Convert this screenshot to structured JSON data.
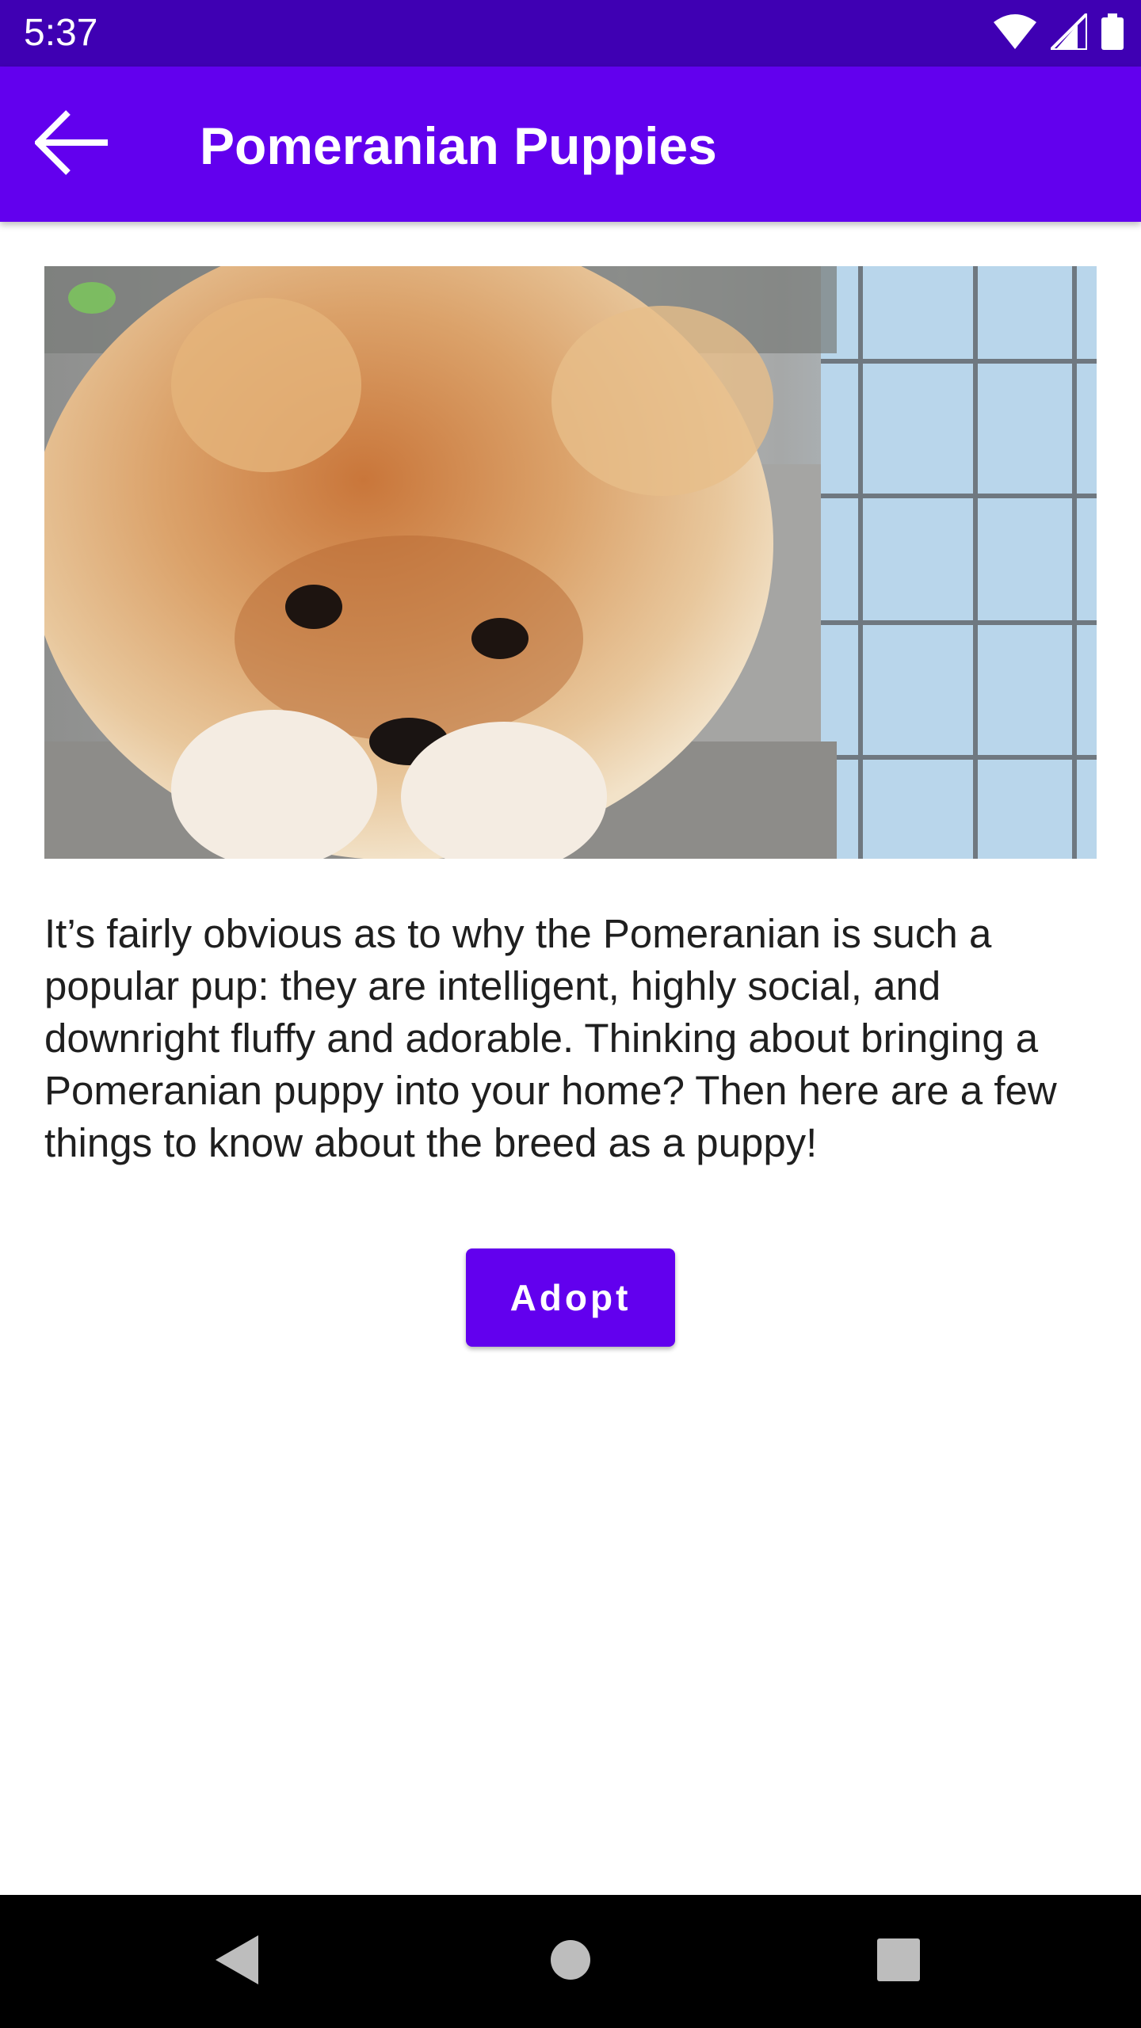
{
  "status_bar": {
    "time": "5:37",
    "icons": [
      "wifi-icon",
      "cellular-signal-icon",
      "battery-icon"
    ]
  },
  "app_bar": {
    "back_icon": "arrow-back-icon",
    "title": "Pomeranian Puppies",
    "background": "#6200ee"
  },
  "content": {
    "image_subject": "pomeranian-puppy-photo",
    "description": "It’s fairly obvious as to why the Pomeranian is such a popular pup: they are intelligent, highly social, and downright fluffy and adorable. Thinking about bringing a Pomeranian puppy into your home? Then here are a few things to know about the breed as a puppy!",
    "adopt_label": "Adopt"
  },
  "nav_bar": {
    "icons": [
      "back-triangle-icon",
      "home-circle-icon",
      "recents-square-icon"
    ]
  },
  "colors": {
    "status_bar": "#3f00b3",
    "primary": "#6200ee",
    "text": "#1f1f1f"
  }
}
